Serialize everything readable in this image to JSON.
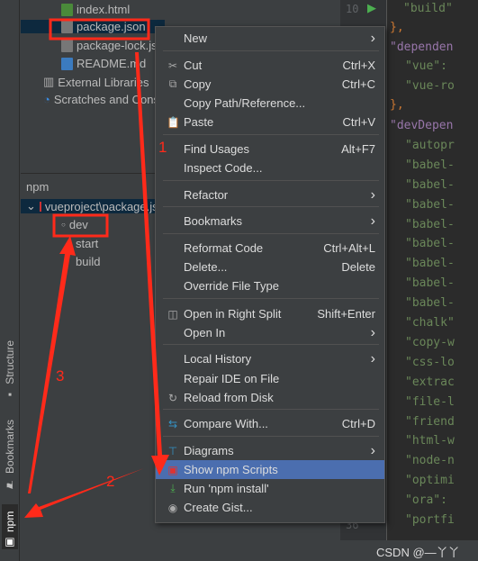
{
  "project_tree": {
    "items": [
      "index.html",
      "package.json",
      "package-lock.json",
      "README.md",
      "External Libraries",
      "Scratches and Consoles"
    ]
  },
  "npm_panel": {
    "title": "npm",
    "root": "vueproject\\package.json",
    "scripts": [
      "dev",
      "start",
      "build"
    ]
  },
  "side_tabs": [
    "Structure",
    "Bookmarks",
    "npm"
  ],
  "context_menu": [
    {
      "label": "New",
      "submenu": true,
      "icon": ""
    },
    {
      "label": "Cut",
      "shortcut": "Ctrl+X",
      "icon": "scissors-icon"
    },
    {
      "label": "Copy",
      "shortcut": "Ctrl+C",
      "icon": "copy-icon"
    },
    {
      "label": "Copy Path/Reference...",
      "icon": ""
    },
    {
      "label": "Paste",
      "shortcut": "Ctrl+V",
      "icon": "clipboard-icon"
    },
    {
      "label": "Find Usages",
      "shortcut": "Alt+F7",
      "icon": ""
    },
    {
      "label": "Inspect Code...",
      "icon": ""
    },
    {
      "label": "Refactor",
      "submenu": true,
      "icon": ""
    },
    {
      "label": "Bookmarks",
      "submenu": true,
      "icon": ""
    },
    {
      "label": "Reformat Code",
      "shortcut": "Ctrl+Alt+L",
      "icon": ""
    },
    {
      "label": "Delete...",
      "shortcut": "Delete",
      "icon": ""
    },
    {
      "label": "Override File Type",
      "icon": ""
    },
    {
      "label": "Open in Right Split",
      "shortcut": "Shift+Enter",
      "icon": "split-icon"
    },
    {
      "label": "Open In",
      "submenu": true,
      "icon": ""
    },
    {
      "label": "Local History",
      "submenu": true,
      "icon": ""
    },
    {
      "label": "Repair IDE on File",
      "icon": ""
    },
    {
      "label": "Reload from Disk",
      "icon": "reload-icon"
    },
    {
      "label": "Compare With...",
      "shortcut": "Ctrl+D",
      "icon": "compare-icon"
    },
    {
      "label": "Diagrams",
      "submenu": true,
      "icon": "diagram-icon"
    },
    {
      "label": "Show npm Scripts",
      "icon": "npm-icon",
      "highlighted": true
    },
    {
      "label": "Run 'npm install'",
      "icon": "download-icon"
    },
    {
      "label": "Create Gist...",
      "icon": "github-icon"
    }
  ],
  "editor": {
    "line_numbers": [
      "10",
      "36"
    ],
    "lines": [
      "\"build\"",
      "},",
      "\"dependen",
      "\"vue\":",
      "\"vue-ro",
      "},",
      "\"devDepen",
      "\"autopr",
      "\"babel-",
      "\"babel-",
      "\"babel-",
      "\"babel-",
      "\"babel-",
      "\"babel-",
      "\"babel-",
      "\"babel-",
      "\"chalk\"",
      "\"copy-w",
      "\"css-lo",
      "\"extrac",
      "\"file-l",
      "\"friend",
      "\"html-w",
      "\"node-n",
      "\"optimi",
      "\"ora\":",
      "\"portfi"
    ]
  },
  "annotations": [
    "1",
    "2",
    "3"
  ],
  "watermark": "CSDN @—丫丫",
  "colors": {
    "menu_highlight": "#4b6eaf",
    "annotation": "#ff2a1a",
    "editor_bg": "#2b2b2b",
    "panel_bg": "#3c3f41"
  }
}
